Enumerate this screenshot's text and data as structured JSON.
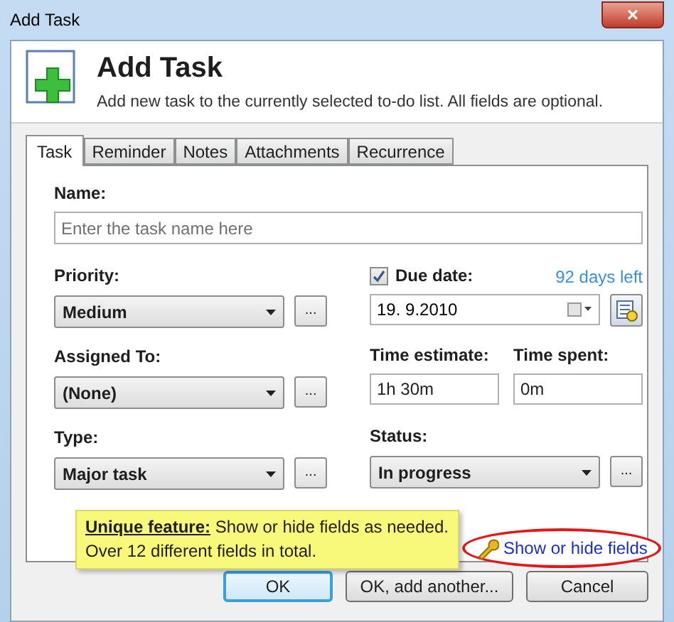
{
  "window": {
    "title": "Add Task",
    "close": "×"
  },
  "header": {
    "title": "Add Task",
    "description": "Add new task to the currently selected to-do list. All fields are optional."
  },
  "tabs": [
    {
      "label": "Task",
      "selected": true
    },
    {
      "label": "Reminder",
      "selected": false
    },
    {
      "label": "Notes",
      "selected": false
    },
    {
      "label": "Attachments",
      "selected": false
    },
    {
      "label": "Recurrence",
      "selected": false
    }
  ],
  "name": {
    "label": "Name:",
    "placeholder": "Enter the task name here"
  },
  "left_fields": [
    {
      "label": "Priority:",
      "value": "Medium",
      "more": "..."
    },
    {
      "label": "Assigned To:",
      "value": "(None)",
      "more": "..."
    },
    {
      "label": "Type:",
      "value": "Major task",
      "more": "..."
    }
  ],
  "due_date": {
    "label": "Due date:",
    "checked": true,
    "value": "19.  9.2010",
    "remaining": "92 days left"
  },
  "time_estimate": {
    "label": "Time estimate:",
    "value": "1h 30m"
  },
  "time_spent": {
    "label": "Time spent:",
    "value": "0m"
  },
  "status": {
    "label": "Status:",
    "value": "In progress",
    "more": "..."
  },
  "note": "**Unique feature:** Show or hide fields as needed. Over 12 different fields in total.",
  "fields_link": "Show or hide fields",
  "buttons": [
    {
      "label": "OK",
      "default": true
    },
    {
      "label": "OK, add another...",
      "default": false
    },
    {
      "label": "Cancel",
      "default": false
    }
  ]
}
